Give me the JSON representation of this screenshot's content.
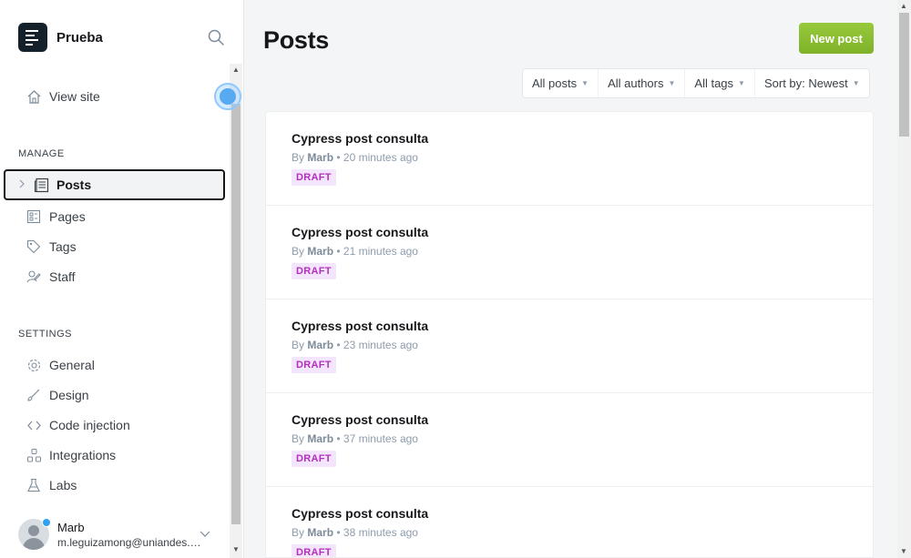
{
  "brand": {
    "name": "Prueba"
  },
  "sidebar": {
    "view_site": "View site",
    "manage_heading": "MANAGE",
    "manage_items": [
      {
        "label": "Posts"
      },
      {
        "label": "Pages"
      },
      {
        "label": "Tags"
      },
      {
        "label": "Staff"
      }
    ],
    "settings_heading": "SETTINGS",
    "settings_items": [
      {
        "label": "General"
      },
      {
        "label": "Design"
      },
      {
        "label": "Code injection"
      },
      {
        "label": "Integrations"
      },
      {
        "label": "Labs"
      }
    ]
  },
  "user": {
    "name": "Marb",
    "email": "m.leguizamong@uniandes.edu.co"
  },
  "main": {
    "title": "Posts",
    "new_post_label": "New post",
    "filters": {
      "type": "All posts",
      "authors": "All authors",
      "tags": "All tags",
      "sort": "Sort by: Newest"
    },
    "posts": [
      {
        "title": "Cypress post consulta",
        "by": "By",
        "author": "Marb",
        "time": "• 20 minutes ago",
        "status": "DRAFT"
      },
      {
        "title": "Cypress post consulta",
        "by": "By",
        "author": "Marb",
        "time": "• 21 minutes ago",
        "status": "DRAFT"
      },
      {
        "title": "Cypress post consulta",
        "by": "By",
        "author": "Marb",
        "time": "• 23 minutes ago",
        "status": "DRAFT"
      },
      {
        "title": "Cypress post consulta",
        "by": "By",
        "author": "Marb",
        "time": "• 37 minutes ago",
        "status": "DRAFT"
      },
      {
        "title": "Cypress post consulta",
        "by": "By",
        "author": "Marb",
        "time": "• 38 minutes ago",
        "status": "DRAFT"
      }
    ]
  },
  "colors": {
    "accent_green": "#8ec032",
    "draft_purple": "#b52fbe",
    "focus_blue": "#57aaf2"
  }
}
